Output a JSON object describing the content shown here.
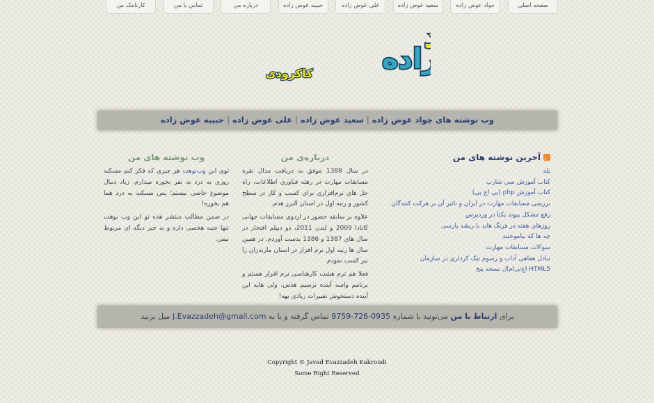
{
  "nav": {
    "tabs": [
      "صفحه اصلی",
      "جواد عوض زاده",
      "سعید عوض زاده",
      "علی عوض زاده",
      "حبیبه عوض زاده",
      "درباره من",
      "تماس با من",
      "کارنامک من"
    ]
  },
  "logo": {
    "line1": "جواد",
    "line2": "عوض زاده",
    "line3": "کاکرودی"
  },
  "blogbar": {
    "links": [
      "وب نوشته های جواد عوض زاده",
      "سعید عوض زاده",
      "علی عوض زاده",
      "حبیبه عوض زاده"
    ],
    "separator": "|"
  },
  "latest_posts": {
    "title": "آخرین نوشته های من",
    "items": [
      "بله",
      "کتاب آموزش سی شارپ",
      "کتاب آموزش php (پی اچ پی)",
      "بررسی مسابقات مهارت در ایران و تاثیر آن بر هرکت کنندگان",
      "رفع مشکل پیوند یکتا در وردپرس",
      "روزهای هفته در فرنگ هاید با ریشه پارسی",
      "چه ها که نیاموختند",
      "سوالات مسابقات مهارت",
      "تبادل هفاهی آداب و رسوم تیک کرداری در سازمان",
      "HTML5 اچ‌تی‌ام‌ال نسخه پنج"
    ]
  },
  "about": {
    "title": "درباره‌ی من",
    "paragraphs": [
      "در سال 1388 موفق به دریافت مدال نقره مسابقات مهارت در رهته فناوری اطلاعات، راه حل های نرم‌افزاری برای کسب و کار در سطح کشور و رتبه اول در استان البرز هدم.",
      "علاوه بر سابقه حضور در اردوی مسابقات جهانی کانادا 2009 و لندن 2011، دو دیپلم افتخار در سال های 1387 و 1386 بدست آوردم. در همین سال ها رتبه اول نرم افزار در استان مازندران را نیز کسب نمودم.",
      "فعلا هم ترم هشت کارهناسی نرم افزار هستم و برنامم واسه آینده ترسیم هدس، ولی هاید این آینده دستخوش تغییرات زیادی بهه!"
    ]
  },
  "blogs": {
    "title": "وب نوشته های من",
    "p1_pre": "توی این ",
    "p1_link": "وب‌نوهت",
    "p1_post": " هر چیزی که فکر کنم مسکنه روزی به درد به نفر بخوره میذارم، زیاد دنبال موضوع خاصی نیستم؛ پس مسکنه به درد هما هم بخوره!",
    "p2": "در ضمن مطالب منتشر هده تو این وب نوهت تنها جنبه هخصی داره و به چیز دیگه ای مربوط نیس."
  },
  "contact": {
    "pre": "برای ",
    "link": "ارتباط با من",
    "mid": " می‌تونید با شماره ",
    "phone": "0935-726-9759",
    "mid2": " تماس گرفته و یا به ",
    "email": "J.Evazzadeh@gmail.com",
    "post": " میل بزنید"
  },
  "footer": {
    "copyright": "Copyright © Javad Evazzadeh Kakroudi",
    "rights": "Some Right Reserved"
  },
  "colors": {
    "accent_blue": "#2a3d73",
    "link_blue": "#3b5aa3",
    "bar_gray": "#b5b5ad",
    "logo_yellow": "#f2e21a",
    "logo_teal": "#35a7c6",
    "rss_orange": "#f08a24"
  }
}
